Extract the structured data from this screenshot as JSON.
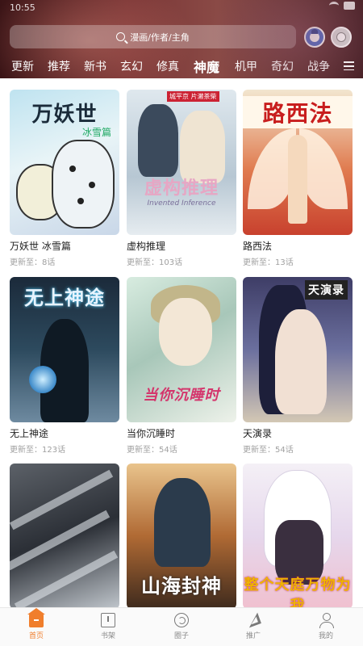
{
  "status_bar": {
    "time": "10:55"
  },
  "search": {
    "placeholder": "漫画/作者/主角"
  },
  "tabs": [
    "更新",
    "推荐",
    "新书",
    "玄幻",
    "修真",
    "神魔",
    "机甲",
    "奇幻",
    "战争"
  ],
  "active_tab": "神魔",
  "comics": [
    {
      "name": "万妖世 冰雪篇",
      "update": "更新至：8话",
      "cover_text": "万妖世",
      "cover_sub": "冰雪篇"
    },
    {
      "name": "虚构推理",
      "update": "更新至：103话",
      "cover_text": "虚构推理",
      "cover_sub": "Invented Inference",
      "cover_author": "城平京 片濑茶柴"
    },
    {
      "name": "路西法",
      "update": "更新至：13话",
      "cover_text": "路西法"
    },
    {
      "name": "无上神途",
      "update": "更新至：123话",
      "cover_text": "无上神途"
    },
    {
      "name": "当你沉睡时",
      "update": "更新至：54话",
      "cover_text": "当你沉睡时"
    },
    {
      "name": "天演录",
      "update": "更新至：54话",
      "cover_text": "天演录"
    },
    {
      "name": "",
      "update": "",
      "cover_text": ""
    },
    {
      "name": "",
      "update": "",
      "cover_text": "山海封神"
    },
    {
      "name": "",
      "update": "",
      "cover_text": "整个天庭万物为我"
    }
  ],
  "bottom_nav": [
    {
      "label": "首页",
      "icon": "home-icon",
      "active": true
    },
    {
      "label": "书架",
      "icon": "bookshelf-icon",
      "active": false
    },
    {
      "label": "圈子",
      "icon": "community-icon",
      "active": false
    },
    {
      "label": "推广",
      "icon": "promote-icon",
      "active": false
    },
    {
      "label": "我的",
      "icon": "profile-icon",
      "active": false
    }
  ],
  "colors": {
    "accent": "#f07e2c",
    "header": "#7a3535",
    "muted_text": "#a0a0a0"
  }
}
